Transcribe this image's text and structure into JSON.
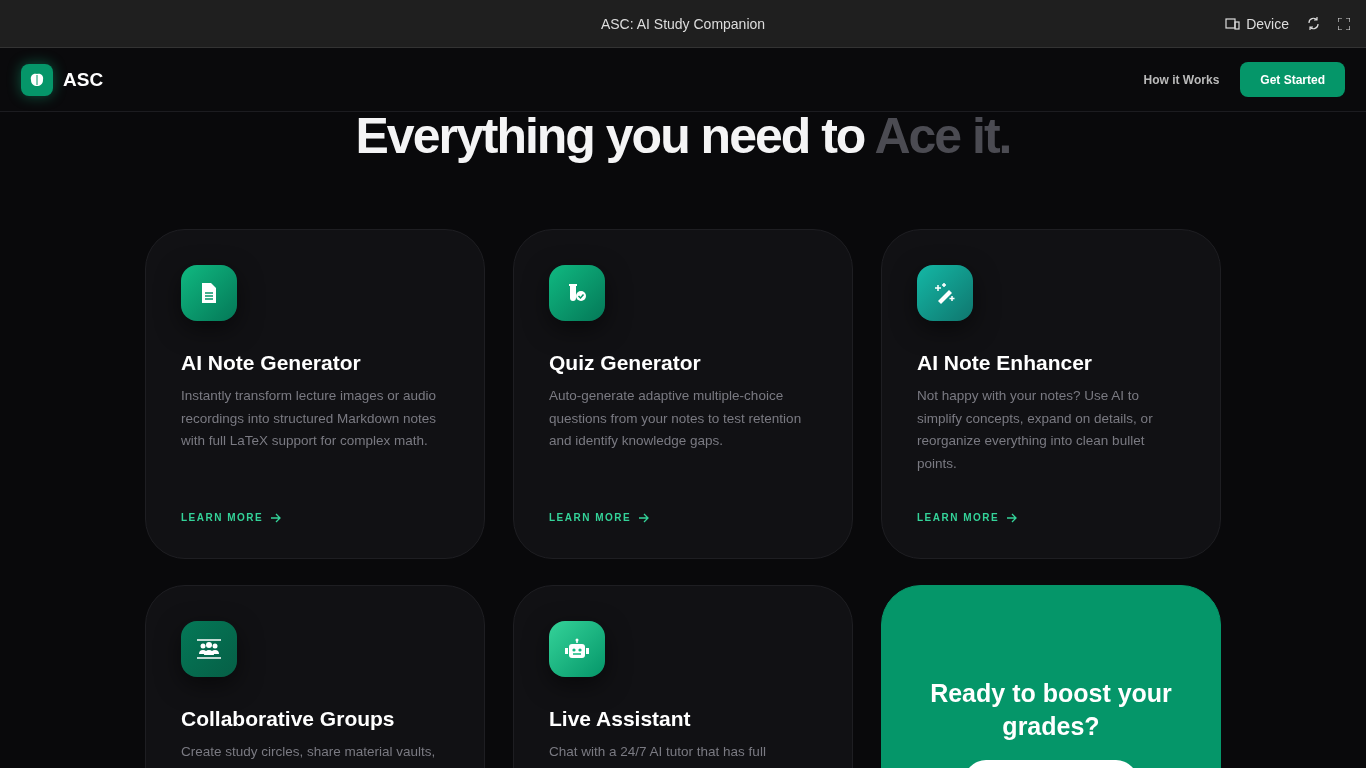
{
  "window": {
    "title": "ASC: AI Study Companion",
    "device_label": "Device"
  },
  "nav": {
    "logo": "ASC",
    "links": [
      "How it Works"
    ],
    "cta": "Get Started"
  },
  "hero": {
    "heading": "Everything you need to ",
    "heading_muted": "Ace it."
  },
  "features": [
    {
      "kind": "feature",
      "title": "AI Note Generator",
      "description": "Instantly transform lecture images or audio recordings into structured Markdown notes with full LaTeX support for complex math.",
      "link": "LEARN MORE"
    },
    {
      "kind": "feature",
      "title": "Quiz Generator",
      "description": "Auto-generate adaptive multiple-choice questions from your notes to test retention and identify knowledge gaps.",
      "link": "LEARN MORE"
    },
    {
      "kind": "feature",
      "title": "AI Note Enhancer",
      "description": "Not happy with your notes? Use AI to simplify concepts, expand on details, or reorganize everything into clean bullet points.",
      "link": "LEARN MORE"
    },
    {
      "kind": "feature",
      "title": "Collaborative Groups",
      "description": "Create study circles, share material vaults,"
    },
    {
      "kind": "feature",
      "title": "Live Assistant",
      "description": "Chat with a 24/7 AI tutor that has full"
    },
    {
      "kind": "cta",
      "title": "Ready to boost your grades?"
    }
  ]
}
